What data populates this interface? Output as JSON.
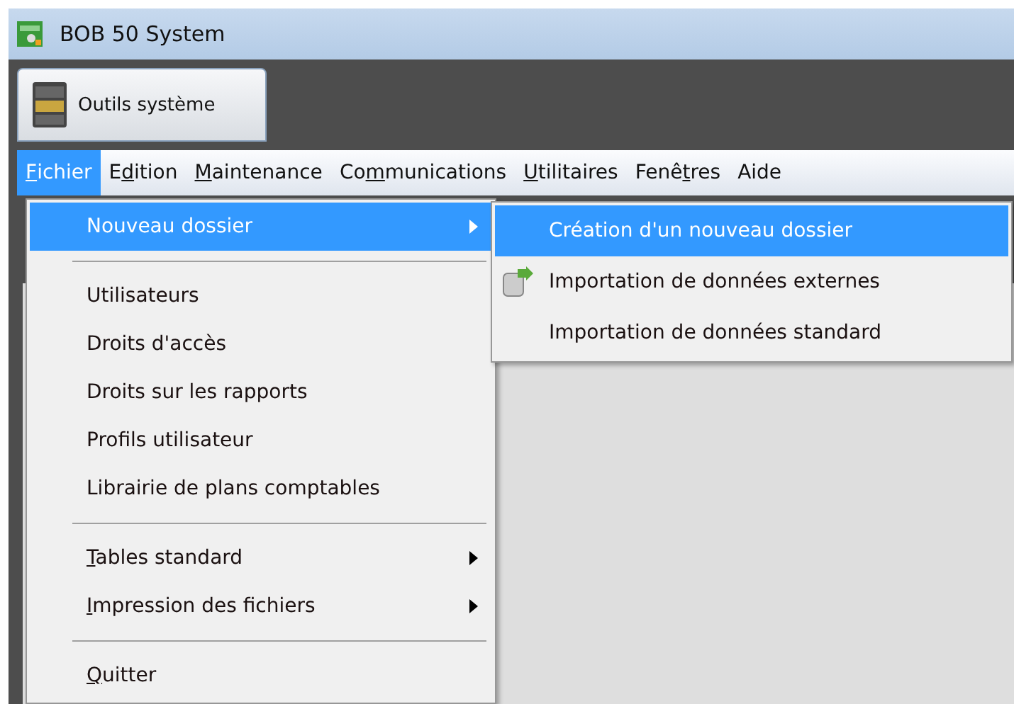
{
  "window": {
    "title": "BOB 50 System"
  },
  "tabs": [
    {
      "label": "Outils système",
      "selected": true
    }
  ],
  "menu_bar": [
    {
      "access_key": "F",
      "label_rest": "ichier",
      "selected": true
    },
    {
      "label_start": "E",
      "access_key": "d",
      "label_rest": "ition",
      "selected": false
    },
    {
      "access_key": "M",
      "label_rest": "aintenance",
      "selected": false
    },
    {
      "label_start": "Co",
      "access_key": "m",
      "label_rest": "munications",
      "selected": false
    },
    {
      "access_key": "U",
      "label_rest": "tilitaires",
      "selected": false
    },
    {
      "label_start": "Fenê",
      "access_key": "t",
      "label_rest": "res",
      "selected": false
    },
    {
      "label_start": "Aide",
      "selected": false
    }
  ],
  "file_menu": [
    {
      "kind": "item",
      "label_start": "Nouveau dossier",
      "submenu": true,
      "selected": true
    },
    {
      "kind": "separator"
    },
    {
      "kind": "item",
      "label_start": "Utilisateurs",
      "submenu": false,
      "selected": false
    },
    {
      "kind": "item",
      "label_start": "Droits d'accès",
      "submenu": false,
      "selected": false
    },
    {
      "kind": "item",
      "label_start": "Droits sur les rapports",
      "submenu": false,
      "selected": false
    },
    {
      "kind": "item",
      "label_start": "Profils utilisateur",
      "submenu": false,
      "selected": false
    },
    {
      "kind": "item",
      "label_start": "Librairie de plans comptables",
      "submenu": false,
      "selected": false
    },
    {
      "kind": "separator"
    },
    {
      "kind": "item",
      "access_key": "T",
      "label_rest": "ables standard",
      "submenu": true,
      "selected": false
    },
    {
      "kind": "item",
      "access_key": "I",
      "label_rest": "mpression des fichiers",
      "submenu": true,
      "selected": false
    },
    {
      "kind": "separator"
    },
    {
      "kind": "item",
      "access_key": "Q",
      "label_rest": "uitter",
      "submenu": false,
      "selected": false
    }
  ],
  "submenu": [
    {
      "label": "Création d'un nouveau dossier",
      "icon": false,
      "selected": true
    },
    {
      "label": "Importation de données externes",
      "icon": true,
      "selected": false
    },
    {
      "label": "Importation de données standard",
      "icon": false,
      "selected": false
    }
  ]
}
